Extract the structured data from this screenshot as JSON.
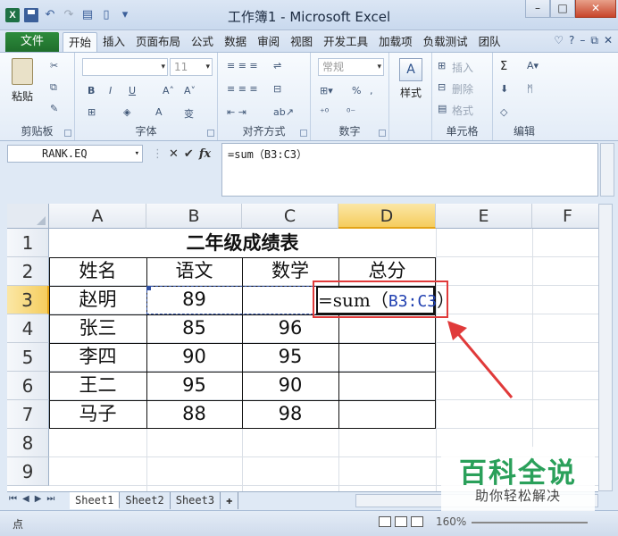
{
  "window": {
    "title": "工作簿1 - Microsoft Excel",
    "controls": [
      "–",
      "□",
      "✕"
    ]
  },
  "qat": {
    "logo": "X",
    "undo": "↶",
    "redo": "↷"
  },
  "ribbon_tabs": {
    "file": "文件",
    "tabs": [
      "开始",
      "插入",
      "页面布局",
      "公式",
      "数据",
      "审阅",
      "视图",
      "开发工具",
      "加载项",
      "负载测试",
      "团队"
    ],
    "active_index": 0,
    "help_icons": [
      "♡",
      "?",
      "–",
      "⧉",
      "✕"
    ]
  },
  "ribbon": {
    "clipboard": {
      "label": "剪贴板",
      "paste": "粘贴"
    },
    "font": {
      "label": "字体",
      "font_name": "",
      "font_size": "11",
      "bold": "B",
      "italic": "I",
      "underline": "U",
      "grow": "A˄",
      "shrink": "A˅",
      "pinyin": "变"
    },
    "alignment": {
      "label": "对齐方式"
    },
    "number": {
      "label": "数字",
      "format": "常规",
      "percent": "%"
    },
    "styles": {
      "label": "样式",
      "button": "样式"
    },
    "cells": {
      "label": "单元格",
      "insert": "插入",
      "delete": "删除",
      "format": "格式"
    },
    "editing": {
      "label": "编辑",
      "sum": "Σ",
      "sort": "A▾",
      "find": "ᛗ"
    }
  },
  "formula_bar": {
    "name_box": "RANK.EQ",
    "cancel": "✕",
    "enter": "✔",
    "fx": "fx",
    "formula": "=sum（B3:C3）"
  },
  "grid": {
    "columns": [
      "A",
      "B",
      "C",
      "D",
      "E",
      "F"
    ],
    "selected_column": "D",
    "rows": [
      "1",
      "2",
      "3",
      "4",
      "5",
      "6",
      "7",
      "8",
      "9"
    ],
    "selected_row": "3",
    "table_title": "二年级成绩表",
    "headers": [
      "姓名",
      "语文",
      "数学",
      "总分"
    ],
    "records": [
      {
        "name": "赵明",
        "chinese": "89",
        "math": "",
        "total": ""
      },
      {
        "name": "张三",
        "chinese": "85",
        "math": "96",
        "total": ""
      },
      {
        "name": "李四",
        "chinese": "90",
        "math": "95",
        "total": ""
      },
      {
        "name": "王二",
        "chinese": "95",
        "math": "90",
        "total": ""
      },
      {
        "name": "马子",
        "chinese": "88",
        "math": "98",
        "total": ""
      }
    ],
    "active_cell_prefix": "=sum（",
    "active_cell_ref": "B3:C3",
    "active_cell_suffix": "）"
  },
  "sheets": {
    "tabs": [
      "Sheet1",
      "Sheet2",
      "Sheet3"
    ],
    "active_index": 0
  },
  "status": {
    "mode": "点",
    "zoom": "160%"
  },
  "watermark": {
    "title": "百科全说",
    "subtitle": "助你轻松解决"
  },
  "colors": {
    "accent_green": "#1f6e2c",
    "highlight_red": "#e03a3a",
    "selection_gold": "#f5cd5e",
    "ref_blue": "#1f3fb0"
  }
}
